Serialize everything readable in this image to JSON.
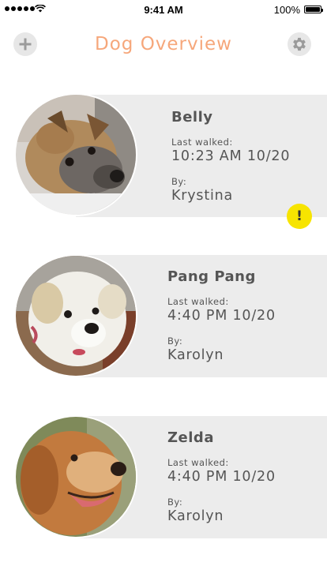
{
  "status_bar": {
    "time": "9:41 AM",
    "battery": "100%"
  },
  "header": {
    "title": "Dog Overview",
    "add_icon": "plus-icon",
    "settings_icon": "gear-icon"
  },
  "colors": {
    "title": "#f6a77b",
    "card_bg": "#ececec",
    "alert": "#f7e400",
    "button_bg": "#e7e7e7"
  },
  "dogs": [
    {
      "name": "Belly",
      "last_walked_label": "Last walked:",
      "last_walked": "10:23 AM 10/20",
      "by_label": "By:",
      "by": "Krystina",
      "alert": "!"
    },
    {
      "name": "Pang Pang",
      "last_walked_label": "Last walked:",
      "last_walked": "4:40 PM 10/20",
      "by_label": "By:",
      "by": "Karolyn"
    },
    {
      "name": "Zelda",
      "last_walked_label": "Last walked:",
      "last_walked": "4:40 PM 10/20",
      "by_label": "By:",
      "by": "Karolyn"
    }
  ]
}
